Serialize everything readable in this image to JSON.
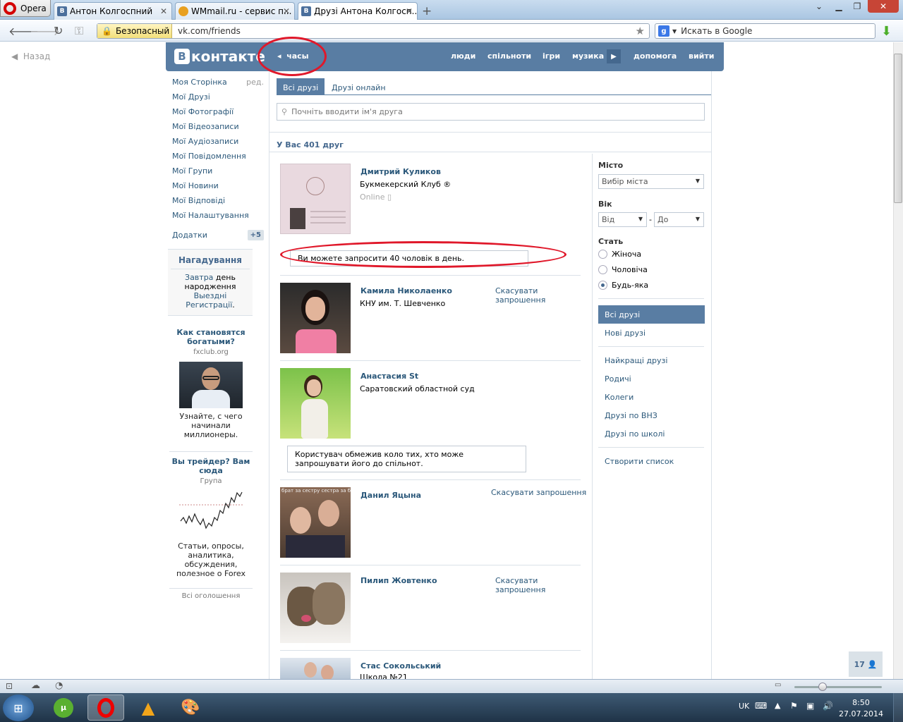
{
  "browser": {
    "menu_label": "Opera",
    "tabs": [
      {
        "label": "Антон Колгоспний",
        "icon": "vk-favicon"
      },
      {
        "label": "WMmail.ru - сервис п...",
        "icon": "wmmail-favicon"
      },
      {
        "label": "Друзі Антона Колгосп...",
        "icon": "vk-favicon"
      }
    ],
    "security_label": "Безопасный",
    "url": "vk.com/friends",
    "search_placeholder": "Искать в Google"
  },
  "page": {
    "back_label": "Назад",
    "logo_text": "контакте",
    "logo_letter": "В",
    "clock_label": "часы",
    "nav": [
      "люди",
      "спільноти",
      "ігри",
      "музика",
      "допомога",
      "вийти"
    ]
  },
  "left_menu": {
    "items": [
      "Моя Сторінка",
      "Мої Друзі",
      "Мої Фотографії",
      "Мої Відеозаписи",
      "Мої Аудіозаписи",
      "Мої Повідомлення",
      "Мої Групи",
      "Мої Новини",
      "Мої Відповіді",
      "Мої Налаштування"
    ],
    "edit_label": "ред.",
    "addons_label": "Додатки",
    "addons_badge": "+5",
    "reminder": {
      "title": "Нагадування",
      "link1": "Завтра",
      "text1": " день народження ",
      "link2": "Выездні Регистрації",
      "text2": "."
    },
    "ads": [
      {
        "title": "Как становятся богатыми?",
        "sub": "fxclub.org",
        "text": "Узнайте, с чего начинали миллионеры."
      },
      {
        "title": "Вы трейдер? Вам сюда",
        "sub": "Група",
        "text": "Статьи, опросы, аналитика, обсуждения, полезное о Forex"
      }
    ],
    "all_ads": "Всі оголошення"
  },
  "main": {
    "tab_all": "Всі друзі",
    "tab_online": "Друзі онлайн",
    "search_placeholder": "Почніть вводити ім'я друга",
    "count_label": "У Вас 401 друг",
    "friends": [
      {
        "name": "Дмитрий Куликов",
        "info": "Букмекерский Клуб ®",
        "status": "Online"
      },
      {
        "name": "Камила Николаенко",
        "info": "КНУ им. Т. Шевченко",
        "action": "Скасувати запрошення"
      },
      {
        "name": "Анастасия St",
        "info": "Саратовский областной суд"
      },
      {
        "name": "Данил Яцына",
        "info": "",
        "action": "Скасувати запрошення"
      },
      {
        "name": "Пилип Жовтенко",
        "info": "",
        "action": "Скасувати запрошення"
      },
      {
        "name": "Стас Сокольський",
        "info": "Школа №21"
      }
    ],
    "notice_invite": "Ви можете запросити 40 чоловік в день.",
    "notice_restricted": "Користувач обмежив коло тих, хто може запрошувати його до спільнот.",
    "photo_caption": "брат за сестру сестра за бра"
  },
  "filter": {
    "city_label": "Місто",
    "city_select": "Вибір міста",
    "age_label": "Вік",
    "age_from": "Від",
    "age_dash": "-",
    "age_to": "До",
    "sex_label": "Стать",
    "sex_options": [
      "Жіноча",
      "Чоловіча",
      "Будь-яка"
    ],
    "sex_selected": "Будь-яка",
    "lists": [
      "Всі друзі",
      "Нові друзі",
      "Найкращі друзі",
      "Родичі",
      "Колеги",
      "Друзі по ВНЗ",
      "Друзі по школі",
      "Створити список"
    ]
  },
  "widgets": {
    "friends_online_count": "17"
  },
  "taskbar": {
    "lang": "UK",
    "time": "8:50",
    "date": "27.07.2014"
  },
  "colors": {
    "vk_blue": "#597da3",
    "link": "#2b587a",
    "annotation": "#e0182a"
  }
}
